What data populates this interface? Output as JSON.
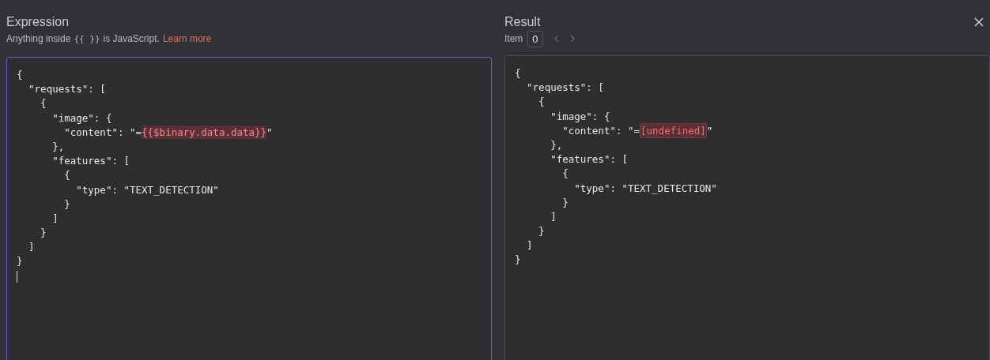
{
  "expression": {
    "title": "Expression",
    "hint": {
      "before": "Anything inside",
      "code": "{{ }}",
      "after": "is JavaScript.",
      "link": "Learn more"
    },
    "editor": {
      "focused": true,
      "cursor": true,
      "lines": [
        {
          "kind": "plain",
          "text": "{"
        },
        {
          "kind": "plain",
          "text": "  \"requests\": ["
        },
        {
          "kind": "plain",
          "text": "    {"
        },
        {
          "kind": "plain",
          "text": "      \"image\": {"
        },
        {
          "kind": "mark",
          "before": "        \"content\": \"=",
          "token": "{{$binary.data.data}}",
          "after": "\""
        },
        {
          "kind": "plain",
          "text": "      },"
        },
        {
          "kind": "plain",
          "text": "      \"features\": ["
        },
        {
          "kind": "plain",
          "text": "        {"
        },
        {
          "kind": "plain",
          "text": "          \"type\": \"TEXT_DETECTION\""
        },
        {
          "kind": "plain",
          "text": "        }"
        },
        {
          "kind": "plain",
          "text": "      ]"
        },
        {
          "kind": "plain",
          "text": "    }"
        },
        {
          "kind": "plain",
          "text": "  ]"
        },
        {
          "kind": "plain",
          "text": "}"
        }
      ]
    }
  },
  "result": {
    "title": "Result",
    "item_label": "Item",
    "item_index": "0",
    "output": {
      "focused": false,
      "cursor": false,
      "lines": [
        {
          "kind": "plain",
          "text": "{"
        },
        {
          "kind": "plain",
          "text": "  \"requests\": ["
        },
        {
          "kind": "plain",
          "text": "    {"
        },
        {
          "kind": "plain",
          "text": "      \"image\": {"
        },
        {
          "kind": "error",
          "before": "        \"content\": \"=",
          "token": "[undefined]",
          "after": "\""
        },
        {
          "kind": "plain",
          "text": "      },"
        },
        {
          "kind": "plain",
          "text": "      \"features\": ["
        },
        {
          "kind": "plain",
          "text": "        {"
        },
        {
          "kind": "plain",
          "text": "          \"type\": \"TEXT_DETECTION\""
        },
        {
          "kind": "plain",
          "text": "        }"
        },
        {
          "kind": "plain",
          "text": "      ]"
        },
        {
          "kind": "plain",
          "text": "    }"
        },
        {
          "kind": "plain",
          "text": "  ]"
        },
        {
          "kind": "plain",
          "text": "}"
        }
      ]
    }
  }
}
